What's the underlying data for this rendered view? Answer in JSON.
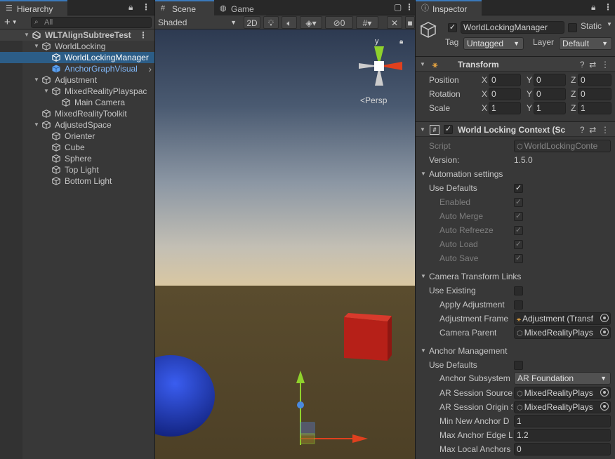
{
  "hierarchy": {
    "tab_label": "Hierarchy",
    "search_placeholder": "All",
    "items": [
      {
        "label": "WLTAlignSubtreeTest",
        "depth": 0,
        "kind": "scene",
        "expanded": true
      },
      {
        "label": "WorldLocking",
        "depth": 1,
        "kind": "go",
        "expanded": true
      },
      {
        "label": "WorldLockingManager",
        "depth": 2,
        "kind": "go",
        "selected": true
      },
      {
        "label": "AnchorGraphVisual",
        "depth": 2,
        "kind": "prefab"
      },
      {
        "label": "Adjustment",
        "depth": 1,
        "kind": "go",
        "expanded": true
      },
      {
        "label": "MixedRealityPlayspac",
        "depth": 2,
        "kind": "go",
        "expanded": true
      },
      {
        "label": "Main Camera",
        "depth": 3,
        "kind": "go"
      },
      {
        "label": "MixedRealityToolkit",
        "depth": 1,
        "kind": "go"
      },
      {
        "label": "AdjustedSpace",
        "depth": 1,
        "kind": "go",
        "expanded": true
      },
      {
        "label": "Orienter",
        "depth": 2,
        "kind": "go"
      },
      {
        "label": "Cube",
        "depth": 2,
        "kind": "go"
      },
      {
        "label": "Sphere",
        "depth": 2,
        "kind": "go"
      },
      {
        "label": "Top Light",
        "depth": 2,
        "kind": "go"
      },
      {
        "label": "Bottom Light",
        "depth": 2,
        "kind": "go"
      }
    ]
  },
  "scene": {
    "tab_scene": "Scene",
    "tab_game": "Game",
    "shading": "Shaded",
    "mode_2d": "2D",
    "hidden_count": "0",
    "persp_label": "Persp",
    "gizmo_y": "y",
    "colors": {
      "cube": "#c8261e",
      "sphere": "#1f3fb8",
      "y_axis": "#8fd12c",
      "x_axis": "#e0401e"
    }
  },
  "inspector": {
    "tab_label": "Inspector",
    "object_name": "WorldLockingManager",
    "static_label": "Static",
    "tag_label": "Tag",
    "tag_value": "Untagged",
    "layer_label": "Layer",
    "layer_value": "Default",
    "transform": {
      "title": "Transform",
      "position_label": "Position",
      "position": {
        "x": "0",
        "y": "0",
        "z": "0"
      },
      "rotation_label": "Rotation",
      "rotation": {
        "x": "0",
        "y": "0",
        "z": "0"
      },
      "scale_label": "Scale",
      "scale": {
        "x": "1",
        "y": "1",
        "z": "1"
      }
    },
    "context": {
      "title": "World Locking Context (Sc",
      "script_label": "Script",
      "script_value": "WorldLockingConte",
      "version_label": "Version:",
      "version_value": "1.5.0",
      "automation_title": "Automation settings",
      "use_defaults_label": "Use Defaults",
      "enabled_label": "Enabled",
      "auto_merge_label": "Auto Merge",
      "auto_refreeze_label": "Auto Refreeze",
      "auto_load_label": "Auto Load",
      "auto_save_label": "Auto Save",
      "camera_links_title": "Camera Transform Links",
      "use_existing_label": "Use Existing",
      "apply_adjustment_label": "Apply Adjustment",
      "adjustment_frame_label": "Adjustment Frame",
      "adjustment_frame_value": "Adjustment (Transf",
      "camera_parent_label": "Camera Parent",
      "camera_parent_value": "MixedRealityPlays",
      "anchor_mgmt_title": "Anchor Management",
      "use_defaults2_label": "Use Defaults",
      "anchor_subsystem_label": "Anchor Subsystem",
      "anchor_subsystem_value": "AR Foundation",
      "ar_session_source_label": "AR Session Source",
      "ar_session_source_value": "MixedRealityPlays",
      "ar_session_origin_label": "AR Session Origin S",
      "ar_session_origin_value": "MixedRealityPlays",
      "min_new_anchor_label": "Min New Anchor D",
      "min_new_anchor_value": "1",
      "max_anchor_edge_label": "Max Anchor Edge L",
      "max_anchor_edge_value": "1.2",
      "max_local_anchors_label": "Max Local Anchors",
      "max_local_anchors_value": "0"
    }
  }
}
